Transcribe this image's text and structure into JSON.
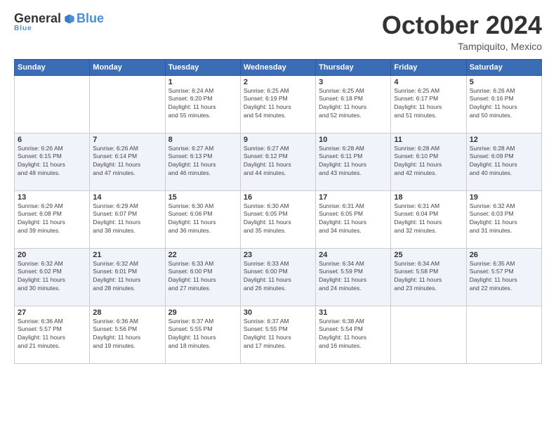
{
  "logo": {
    "general": "General",
    "blue": "Blue",
    "underline": "Blue"
  },
  "header": {
    "month": "October 2024",
    "location": "Tampiquito, Mexico"
  },
  "days_of_week": [
    "Sunday",
    "Monday",
    "Tuesday",
    "Wednesday",
    "Thursday",
    "Friday",
    "Saturday"
  ],
  "weeks": [
    [
      {
        "day": "",
        "detail": ""
      },
      {
        "day": "",
        "detail": ""
      },
      {
        "day": "1",
        "detail": "Sunrise: 6:24 AM\nSunset: 6:20 PM\nDaylight: 11 hours\nand 55 minutes."
      },
      {
        "day": "2",
        "detail": "Sunrise: 6:25 AM\nSunset: 6:19 PM\nDaylight: 11 hours\nand 54 minutes."
      },
      {
        "day": "3",
        "detail": "Sunrise: 6:25 AM\nSunset: 6:18 PM\nDaylight: 11 hours\nand 52 minutes."
      },
      {
        "day": "4",
        "detail": "Sunrise: 6:25 AM\nSunset: 6:17 PM\nDaylight: 11 hours\nand 51 minutes."
      },
      {
        "day": "5",
        "detail": "Sunrise: 6:26 AM\nSunset: 6:16 PM\nDaylight: 11 hours\nand 50 minutes."
      }
    ],
    [
      {
        "day": "6",
        "detail": "Sunrise: 6:26 AM\nSunset: 6:15 PM\nDaylight: 11 hours\nand 48 minutes."
      },
      {
        "day": "7",
        "detail": "Sunrise: 6:26 AM\nSunset: 6:14 PM\nDaylight: 11 hours\nand 47 minutes."
      },
      {
        "day": "8",
        "detail": "Sunrise: 6:27 AM\nSunset: 6:13 PM\nDaylight: 11 hours\nand 46 minutes."
      },
      {
        "day": "9",
        "detail": "Sunrise: 6:27 AM\nSunset: 6:12 PM\nDaylight: 11 hours\nand 44 minutes."
      },
      {
        "day": "10",
        "detail": "Sunrise: 6:28 AM\nSunset: 6:11 PM\nDaylight: 11 hours\nand 43 minutes."
      },
      {
        "day": "11",
        "detail": "Sunrise: 6:28 AM\nSunset: 6:10 PM\nDaylight: 11 hours\nand 42 minutes."
      },
      {
        "day": "12",
        "detail": "Sunrise: 6:28 AM\nSunset: 6:09 PM\nDaylight: 11 hours\nand 40 minutes."
      }
    ],
    [
      {
        "day": "13",
        "detail": "Sunrise: 6:29 AM\nSunset: 6:08 PM\nDaylight: 11 hours\nand 39 minutes."
      },
      {
        "day": "14",
        "detail": "Sunrise: 6:29 AM\nSunset: 6:07 PM\nDaylight: 11 hours\nand 38 minutes."
      },
      {
        "day": "15",
        "detail": "Sunrise: 6:30 AM\nSunset: 6:06 PM\nDaylight: 11 hours\nand 36 minutes."
      },
      {
        "day": "16",
        "detail": "Sunrise: 6:30 AM\nSunset: 6:05 PM\nDaylight: 11 hours\nand 35 minutes."
      },
      {
        "day": "17",
        "detail": "Sunrise: 6:31 AM\nSunset: 6:05 PM\nDaylight: 11 hours\nand 34 minutes."
      },
      {
        "day": "18",
        "detail": "Sunrise: 6:31 AM\nSunset: 6:04 PM\nDaylight: 11 hours\nand 32 minutes."
      },
      {
        "day": "19",
        "detail": "Sunrise: 6:32 AM\nSunset: 6:03 PM\nDaylight: 11 hours\nand 31 minutes."
      }
    ],
    [
      {
        "day": "20",
        "detail": "Sunrise: 6:32 AM\nSunset: 6:02 PM\nDaylight: 11 hours\nand 30 minutes."
      },
      {
        "day": "21",
        "detail": "Sunrise: 6:32 AM\nSunset: 6:01 PM\nDaylight: 11 hours\nand 28 minutes."
      },
      {
        "day": "22",
        "detail": "Sunrise: 6:33 AM\nSunset: 6:00 PM\nDaylight: 11 hours\nand 27 minutes."
      },
      {
        "day": "23",
        "detail": "Sunrise: 6:33 AM\nSunset: 6:00 PM\nDaylight: 11 hours\nand 26 minutes."
      },
      {
        "day": "24",
        "detail": "Sunrise: 6:34 AM\nSunset: 5:59 PM\nDaylight: 11 hours\nand 24 minutes."
      },
      {
        "day": "25",
        "detail": "Sunrise: 6:34 AM\nSunset: 5:58 PM\nDaylight: 11 hours\nand 23 minutes."
      },
      {
        "day": "26",
        "detail": "Sunrise: 6:35 AM\nSunset: 5:57 PM\nDaylight: 11 hours\nand 22 minutes."
      }
    ],
    [
      {
        "day": "27",
        "detail": "Sunrise: 6:36 AM\nSunset: 5:57 PM\nDaylight: 11 hours\nand 21 minutes."
      },
      {
        "day": "28",
        "detail": "Sunrise: 6:36 AM\nSunset: 5:56 PM\nDaylight: 11 hours\nand 19 minutes."
      },
      {
        "day": "29",
        "detail": "Sunrise: 6:37 AM\nSunset: 5:55 PM\nDaylight: 11 hours\nand 18 minutes."
      },
      {
        "day": "30",
        "detail": "Sunrise: 6:37 AM\nSunset: 5:55 PM\nDaylight: 11 hours\nand 17 minutes."
      },
      {
        "day": "31",
        "detail": "Sunrise: 6:38 AM\nSunset: 5:54 PM\nDaylight: 11 hours\nand 16 minutes."
      },
      {
        "day": "",
        "detail": ""
      },
      {
        "day": "",
        "detail": ""
      }
    ]
  ]
}
